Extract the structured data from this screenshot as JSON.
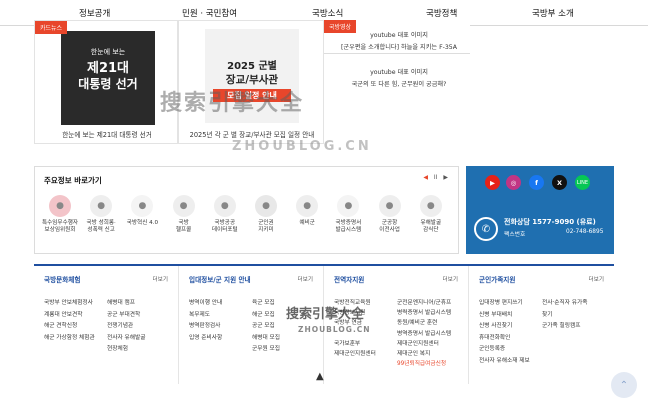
{
  "nav": {
    "items": [
      "정보공개",
      "민원 · 국민참여",
      "국방소식",
      "국방정책",
      "국방부 소개"
    ]
  },
  "news": {
    "card1": {
      "tag": "카드뉴스",
      "thumb_top": "한눈에 보는",
      "thumb_main1": "제21대",
      "thumb_main2": "대통령 선거",
      "caption": "한눈에 보는 제21대 대통령 선거"
    },
    "card2": {
      "thumb_year": "2025 군별",
      "thumb_main": "장교/부사관",
      "thumb_sub": "모집 일정 안내",
      "caption": "2025년 각 군 별 장교/부사관 모집 일정 안내"
    },
    "card3": {
      "tag": "국방영상",
      "items": [
        {
          "line1": "youtube 대표 이미지",
          "line2": "[군우편을 소개합니다] 하늘을 지키는 F-35A"
        },
        {
          "line1": "youtube 대표 이미지",
          "line2": "국군의 또 다른 힘, 군무원이 궁금해?"
        }
      ]
    }
  },
  "quicklinks": {
    "title": "주요정보 바로가기",
    "pager": "II",
    "items": [
      {
        "label1": "특수임무수행자",
        "label2": "보상임위원회",
        "icon": "emblem-icon",
        "color": "#f3c4c9"
      },
      {
        "label1": "국방 성희롱·",
        "label2": "성폭력 신고",
        "icon": "phone-1365-icon",
        "color": "#eee"
      },
      {
        "label1": "국방혁신 4.0",
        "label2": "",
        "icon": "document-icon",
        "color": "#f4f4f4"
      },
      {
        "label1": "국방",
        "label2": "헬프콜",
        "icon": "phone-1303-icon",
        "color": "#eee"
      },
      {
        "label1": "국방공공",
        "label2": "데이터포털",
        "icon": "database-icon",
        "color": "#eee"
      },
      {
        "label1": "군인권",
        "label2": "지키미",
        "icon": "shield-icon",
        "color": "#e8e8e8"
      },
      {
        "label1": "예비군",
        "label2": "",
        "icon": "reserve-icon",
        "color": "#eee"
      },
      {
        "label1": "국방증명서",
        "label2": "발급시스템",
        "icon": "certificate-icon",
        "color": "#f4f4f4"
      },
      {
        "label1": "군공항",
        "label2": "이전사업",
        "icon": "airplane-icon",
        "color": "#eee"
      },
      {
        "label1": "유해발굴",
        "label2": "감식단",
        "icon": "helmet-icon",
        "color": "#eee"
      }
    ]
  },
  "contact": {
    "social": [
      "youtube",
      "instagram",
      "facebook",
      "x",
      "line"
    ],
    "title": "전화상담 1577-9090 (유료)",
    "fax_label": "팩스번호",
    "fax": "02-748-6895"
  },
  "links": {
    "more": "더보기",
    "cols": [
      {
        "title": "국방문화체험",
        "rows": [
          [
            "국방부 안보체험정사",
            "해병대 캠프"
          ],
          [
            "계룡대 안보견학",
            "공군 부대견학"
          ],
          [
            "해군 견학신청",
            "전쟁기념관"
          ],
          [
            "해군 가상함정 체험관",
            "전사자 유해발굴"
          ],
          [
            "",
            "현장체험"
          ]
        ]
      },
      {
        "title": "입대정보/군 지원 안내",
        "rows": [
          [
            "병역이행 안내",
            "육군 모집"
          ],
          [
            "복무제도",
            "해군 모집"
          ],
          [
            "병역판정검사",
            "공군 모집"
          ],
          [
            "입영 준비사항",
            "해병대 모집"
          ],
          [
            "",
            "군무원 모집"
          ]
        ]
      },
      {
        "title": "전역자지원",
        "rows": [
          [
            "국방전직교육원",
            "군전문엔지니어/군휴프"
          ],
          [
            "국방정보지원",
            "병력증명서 발급시스템"
          ],
          [
            "국방부 연금",
            "동원/예비군 훈련"
          ],
          [
            "",
            "병역증명서 발급시스템"
          ],
          [
            "국가보훈부",
            "제대군인지원센터"
          ],
          [
            "제대군인지원센터",
            "제대군인 복지"
          ],
          [
            "",
            "99년퇴직급여금신청"
          ]
        ]
      },
      {
        "title": "군인가족지원",
        "rows": [
          [
            "입대장병 편지쓰기",
            "전사·순직자 유가족"
          ],
          [
            "신병 부대배치",
            "찾기"
          ],
          [
            "신병 사진찾기",
            "군가족 힐링캠프"
          ],
          [
            "휴대전화확인",
            ""
          ],
          [
            "군인등록증",
            ""
          ],
          [
            "전사자 유해소재 제보",
            ""
          ]
        ]
      }
    ]
  },
  "watermark": {
    "line1": "搜索引擎大全",
    "line2": "ZHOUBLOG.CN"
  }
}
